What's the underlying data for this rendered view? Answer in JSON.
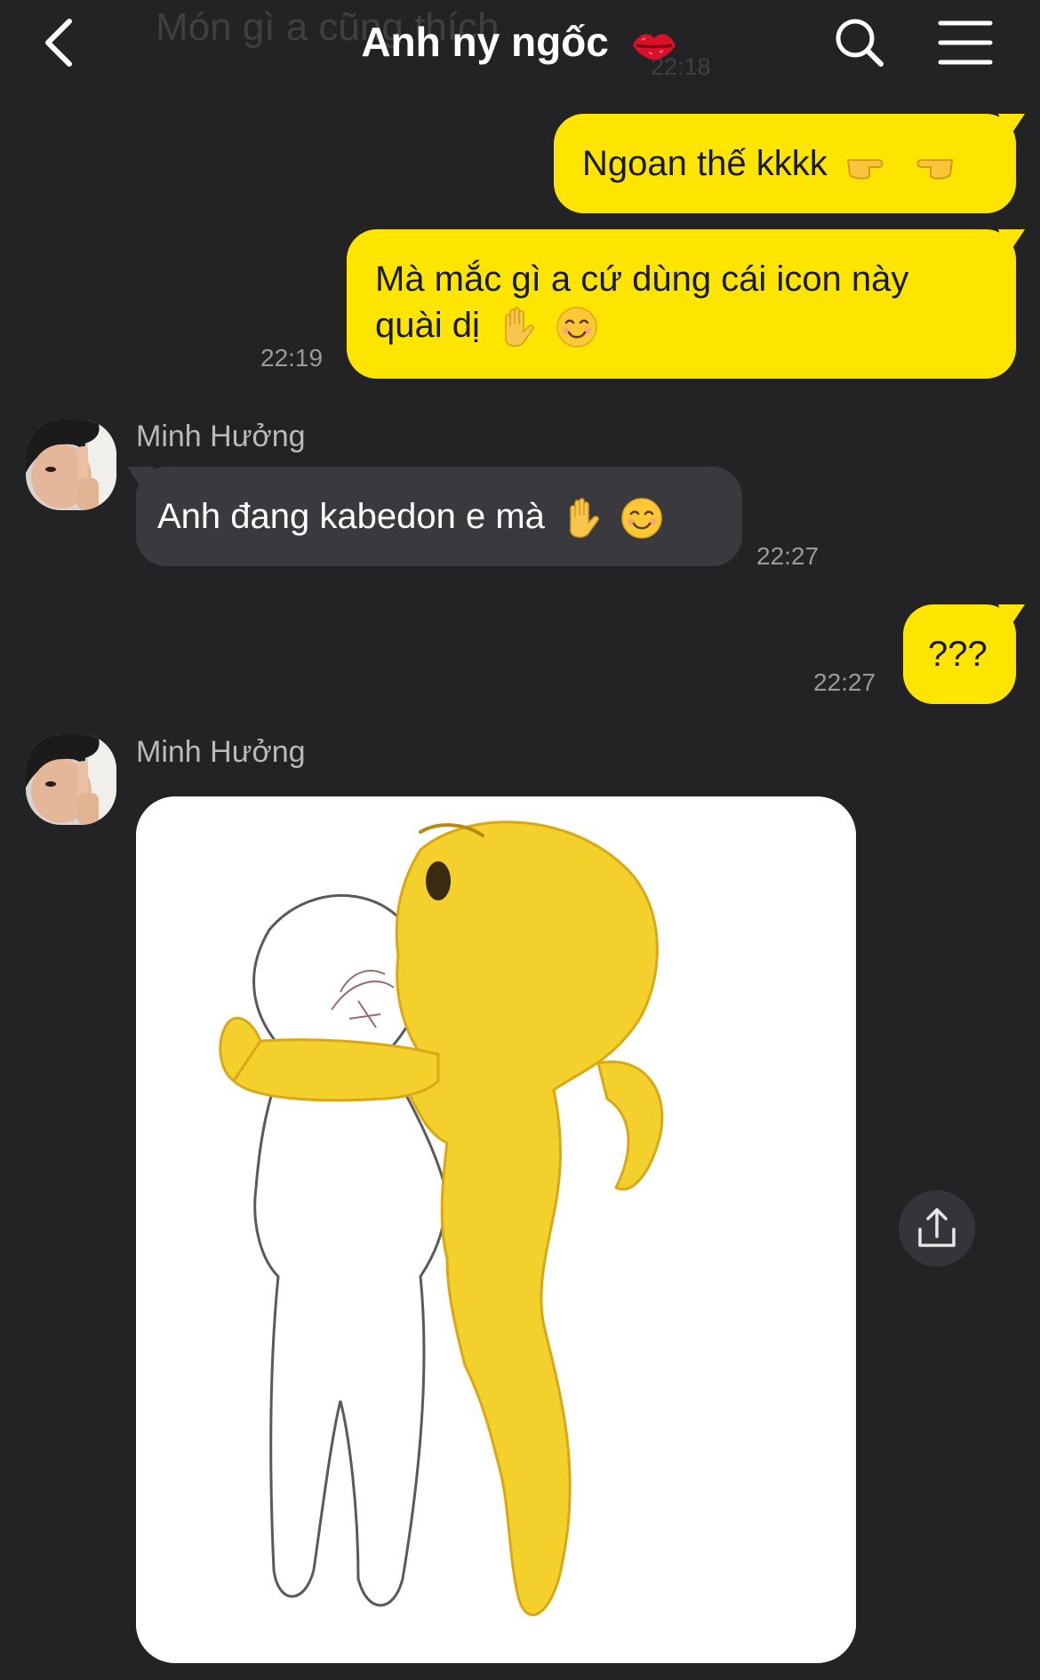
{
  "header": {
    "title": "Anh ny ngốc",
    "previous_message_text": "Món gì a cũng thích",
    "previous_message_time": "22:18"
  },
  "messages": [
    {
      "from": "me",
      "text": "Ngoan thế kkkk",
      "emoji": [
        "pointing-right-icon",
        "pointing-left-icon"
      ],
      "time": ""
    },
    {
      "from": "me",
      "text_line1": "Mà mắc gì a cứ dùng cái icon này",
      "text_line2": "quài dị",
      "emoji": [
        "raised-hand-icon",
        "smiling-face-icon"
      ],
      "time": "22:19"
    },
    {
      "from": "other",
      "sender": "Minh Hưởng",
      "text": "Anh đang kabedon e mà",
      "emoji": [
        "raised-hand-icon",
        "smiling-face-icon"
      ],
      "time": "22:27"
    },
    {
      "from": "me",
      "text": "???",
      "time": "22:27"
    },
    {
      "from": "other",
      "sender": "Minh Hưởng",
      "type": "image",
      "image": "yellow-emoji-kabedon-sticker"
    }
  ],
  "colors": {
    "background": "#232326",
    "my_bubble": "#fee500",
    "their_bubble": "#3a3a3e",
    "timestamp": "#9a9a9e"
  },
  "icons": {
    "back": "chevron-left-icon",
    "search": "search-icon",
    "menu": "hamburger-menu-icon",
    "title_badge": "kiss-lips-icon",
    "share": "share-icon"
  }
}
